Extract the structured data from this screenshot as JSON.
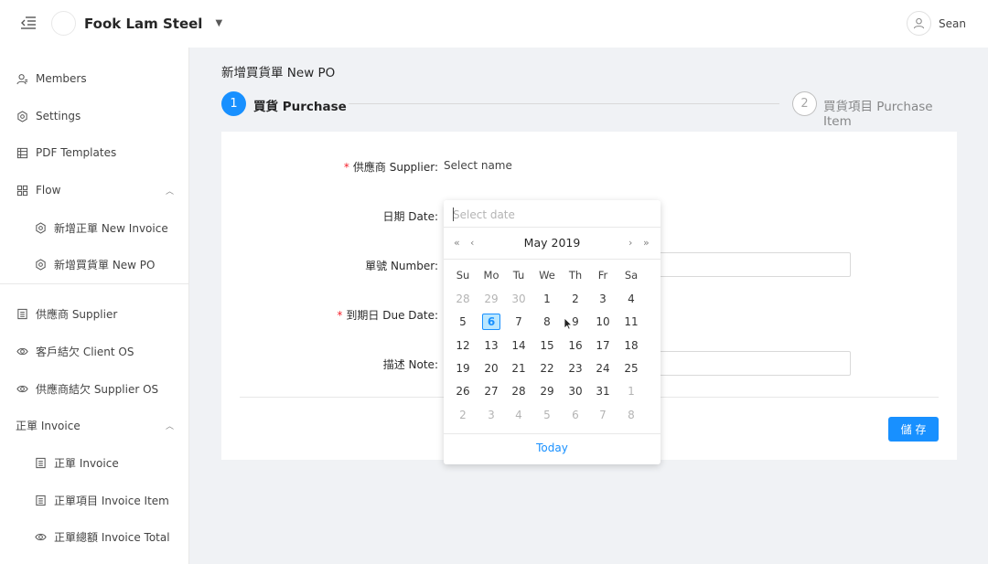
{
  "header": {
    "brand": "Fook Lam Steel",
    "user_name": "Sean"
  },
  "sidebar": {
    "items": [
      {
        "label": "Members",
        "icon": "user-icon"
      },
      {
        "label": "Settings",
        "icon": "gear-icon"
      },
      {
        "label": "PDF Templates",
        "icon": "table-icon"
      },
      {
        "label": "Flow",
        "icon": "grid-icon"
      },
      {
        "label": "新增正單 New Invoice",
        "icon": "gear-icon"
      },
      {
        "label": "新增買貨單 New PO",
        "icon": "gear-icon"
      },
      {
        "label": "供應商 Supplier",
        "icon": "document-icon"
      },
      {
        "label": "客戶結欠 Client OS",
        "icon": "eye-icon"
      },
      {
        "label": "供應商結欠 Supplier OS",
        "icon": "eye-icon"
      },
      {
        "label": "正單 Invoice",
        "icon": ""
      },
      {
        "label": "正單 Invoice",
        "icon": "document-icon"
      },
      {
        "label": "正單項目 Invoice Item",
        "icon": "document-icon"
      },
      {
        "label": "正單總額 Invoice Total",
        "icon": "eye-icon"
      }
    ]
  },
  "main": {
    "title": "新增買貨單 New PO",
    "steps": [
      {
        "num": "1",
        "label": "買貨 Purchase"
      },
      {
        "num": "2",
        "label": "買貨項目 Purchase Item"
      }
    ],
    "form": {
      "supplier_label": "供應商 Supplier",
      "supplier_placeholder": "Select name",
      "date_label": "日期 Date",
      "number_label": "單號 Number",
      "due_label": "到期日 Due Date",
      "note_label": "描述 Note",
      "required_mark": "*",
      "label_colon": ":",
      "save_label": "儲 存"
    }
  },
  "datepicker": {
    "placeholder": "Select date",
    "month": "May 2019",
    "nav_prev_year": "«",
    "nav_prev_month": "‹",
    "nav_next_month": "›",
    "nav_next_year": "»",
    "weekdays": [
      "Su",
      "Mo",
      "Tu",
      "We",
      "Th",
      "Fr",
      "Sa"
    ],
    "weeks": [
      [
        "28",
        "29",
        "30",
        "1",
        "2",
        "3",
        "4"
      ],
      [
        "5",
        "6",
        "7",
        "8",
        "9",
        "10",
        "11"
      ],
      [
        "12",
        "13",
        "14",
        "15",
        "16",
        "17",
        "18"
      ],
      [
        "19",
        "20",
        "21",
        "22",
        "23",
        "24",
        "25"
      ],
      [
        "26",
        "27",
        "28",
        "29",
        "30",
        "31",
        "1"
      ],
      [
        "2",
        "3",
        "4",
        "5",
        "6",
        "7",
        "8"
      ]
    ],
    "selected_day": "6",
    "today_label": "Today"
  },
  "colors": {
    "primary": "#1890ff",
    "required": "#f5222d",
    "selected_bg": "#bae7ff"
  }
}
